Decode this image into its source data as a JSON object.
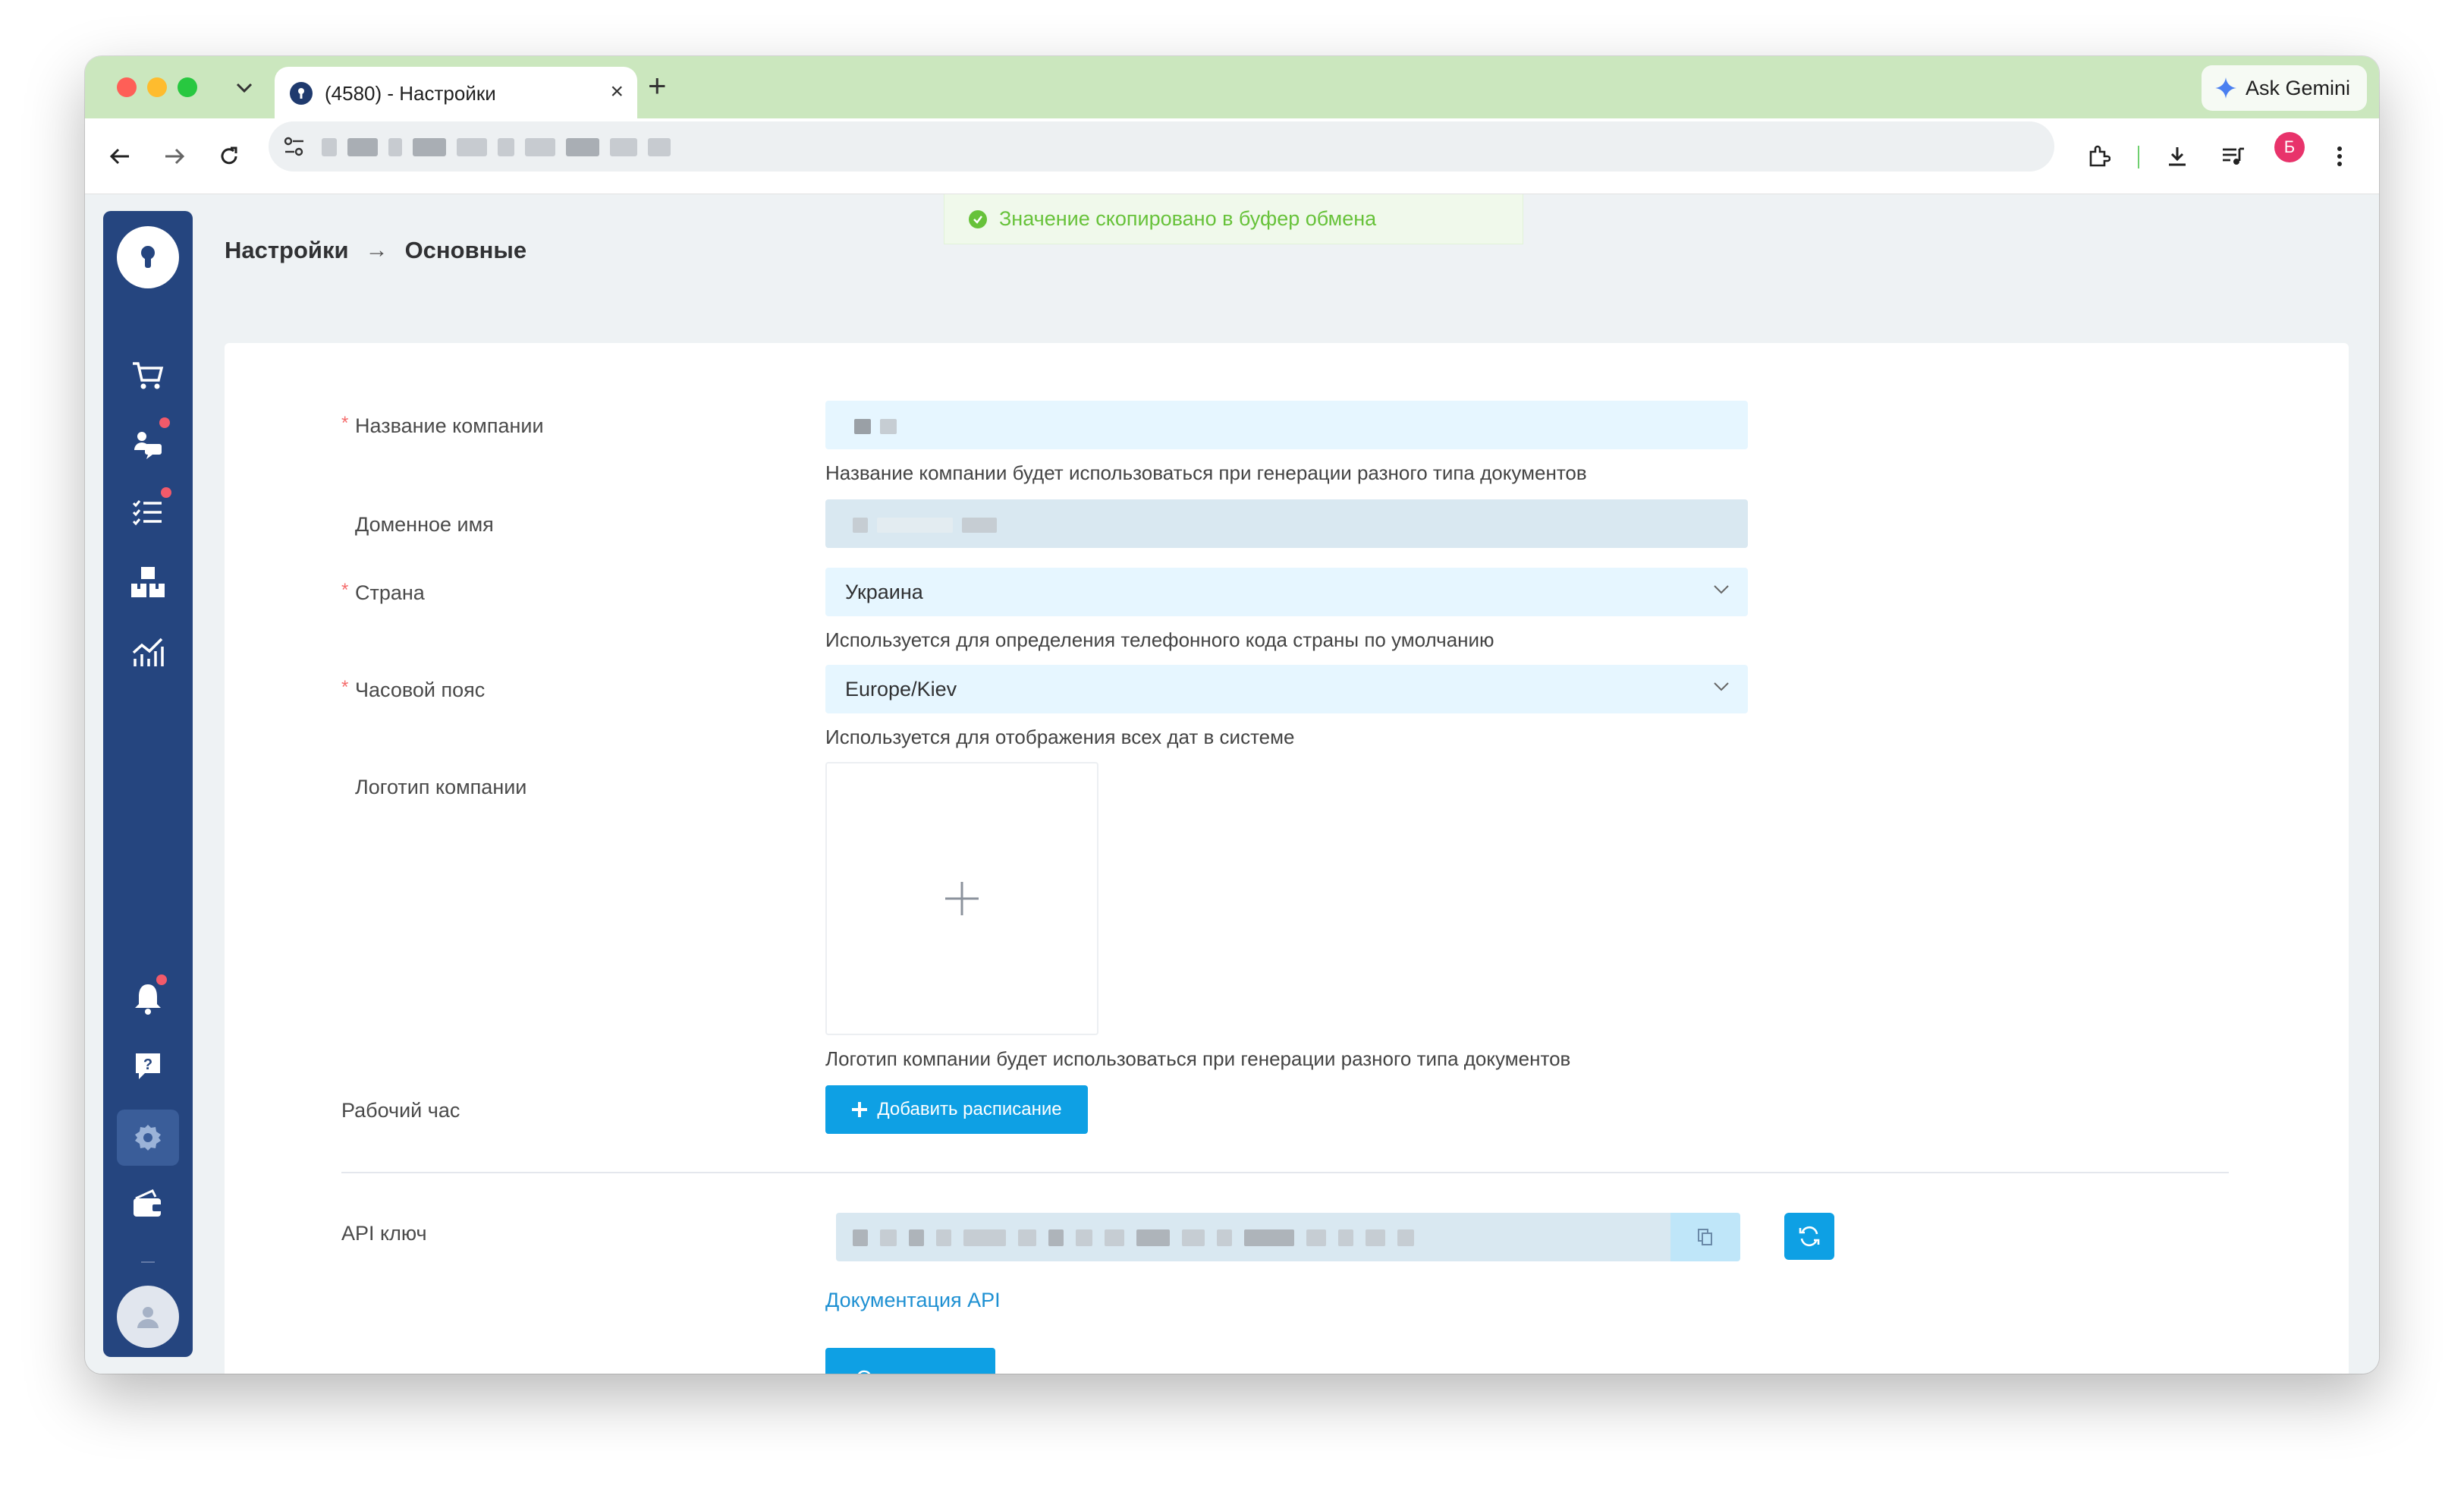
{
  "browser": {
    "tab_title": "(4580) - Настройки",
    "tab_close": "×",
    "new_tab": "+",
    "ask_gemini": "Ask Gemini",
    "profile_initial": "Б"
  },
  "breadcrumb": {
    "parent": "Настройки",
    "separator": "→",
    "current": "Основные"
  },
  "toast": {
    "message": "Значение скопировано в буфер обмена",
    "color": "#67c23a"
  },
  "form": {
    "required_mark": "*",
    "company_name": {
      "label": "Название компании",
      "hint": "Название компании будет использоваться при генерации разного типа документов"
    },
    "domain": {
      "label": "Доменное имя"
    },
    "country": {
      "label": "Страна",
      "value": "Украина",
      "hint": "Используется для определения телефонного кода страны по умолчанию"
    },
    "timezone": {
      "label": "Часовой пояс",
      "value": "Europe/Kiev",
      "hint": "Используется для отображения всех дат в системе"
    },
    "logo": {
      "label": "Логотип компании",
      "hint": "Логотип компании будет использоваться при генерации разного типа документов"
    },
    "working_hours": {
      "label": "Рабочий час",
      "add_button": "Добавить расписание"
    },
    "api_key": {
      "label": "API ключ",
      "docs_link": "Документация API"
    },
    "save_button": "Сохранить"
  },
  "sidebar": {
    "items": [
      {
        "icon": "cart-icon"
      },
      {
        "icon": "customers-icon",
        "badge": true
      },
      {
        "icon": "tasks-icon",
        "badge": true
      },
      {
        "icon": "warehouse-icon"
      },
      {
        "icon": "analytics-icon"
      },
      {
        "icon": "bell-icon",
        "badge": true
      },
      {
        "icon": "help-icon"
      },
      {
        "icon": "gear-icon",
        "active": true
      },
      {
        "icon": "wallet-icon"
      }
    ]
  },
  "colors": {
    "sidebar": "#25457f",
    "accent": "#0ea0e4",
    "required": "#f56c6c",
    "badge": "#f25a6a"
  }
}
